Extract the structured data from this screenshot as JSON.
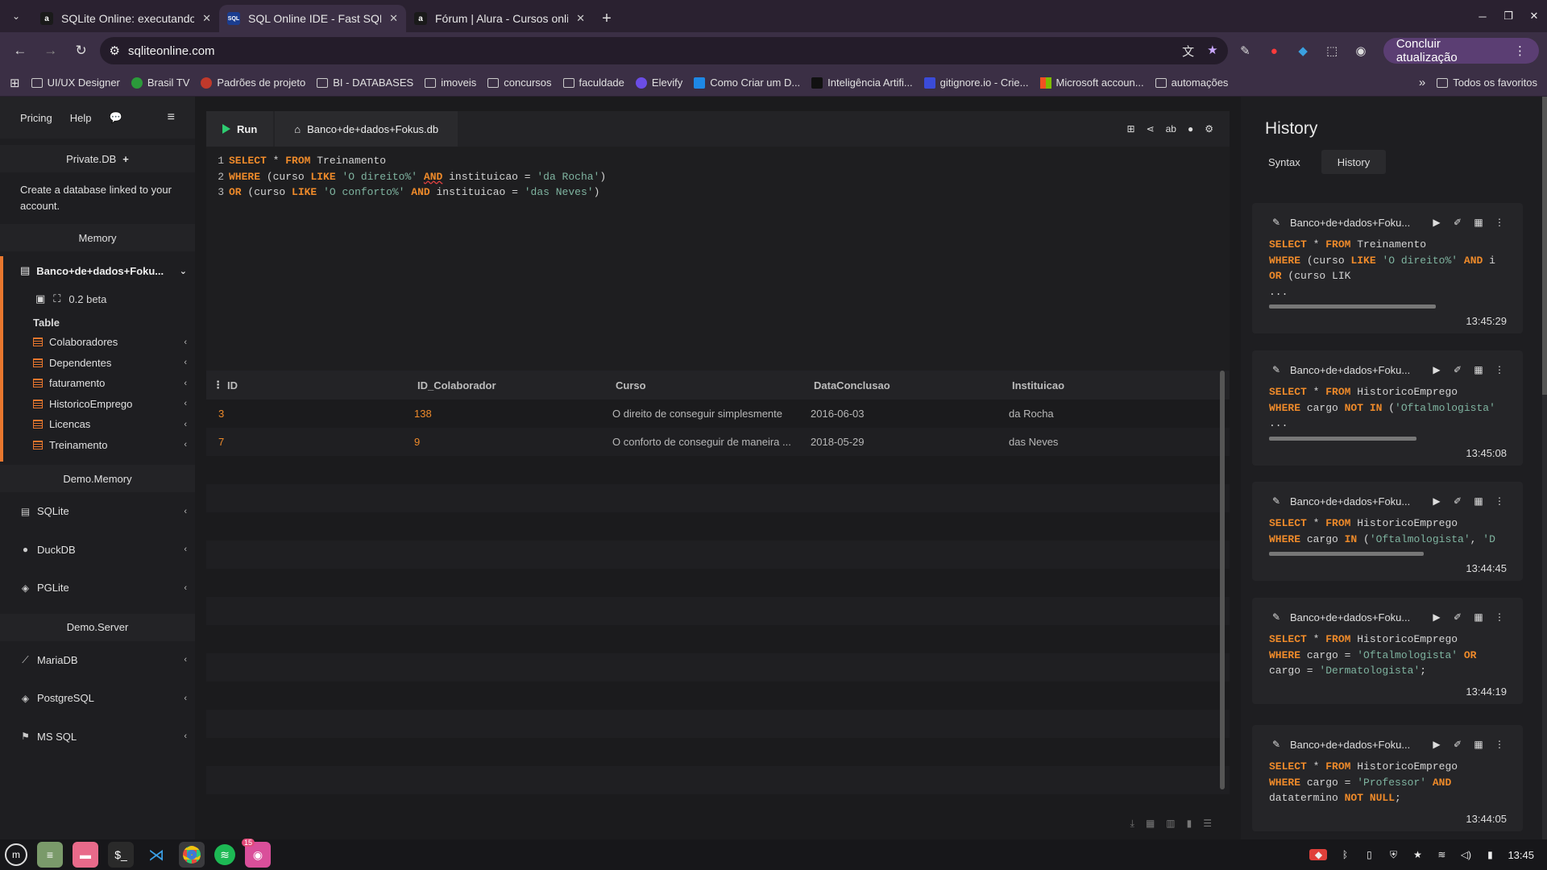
{
  "browser": {
    "tabs": [
      {
        "title": "SQLite Online: executando c",
        "favicon": "a",
        "active": false
      },
      {
        "title": "SQL Online IDE - Fast SQL Ed",
        "favicon": "SQL",
        "active": true
      },
      {
        "title": "Fórum | Alura - Cursos online",
        "favicon": "a",
        "active": false
      }
    ],
    "url": "sqliteonline.com",
    "update_label": "Concluir atualização",
    "bookmarks": [
      {
        "label": "UI/UX Designer",
        "icon": "folder-icon"
      },
      {
        "label": "Brasil TV",
        "icon": "brasiltv-icon"
      },
      {
        "label": "Padrões de projeto",
        "icon": "pattern-icon"
      },
      {
        "label": "BI - DATABASES",
        "icon": "folder-icon"
      },
      {
        "label": "imoveis",
        "icon": "folder-icon"
      },
      {
        "label": "concursos",
        "icon": "folder-icon"
      },
      {
        "label": "faculdade",
        "icon": "folder-icon"
      },
      {
        "label": "Elevify",
        "icon": "elevify-icon"
      },
      {
        "label": "Como Criar um D...",
        "icon": "video-icon"
      },
      {
        "label": "Inteligência Artifi...",
        "icon": "alura-icon"
      },
      {
        "label": "gitignore.io - Crie...",
        "icon": "git-icon"
      },
      {
        "label": "Microsoft accoun...",
        "icon": "microsoft-icon"
      },
      {
        "label": "automações",
        "icon": "folder-icon"
      }
    ],
    "bookmarks_all": "Todos os favoritos"
  },
  "sidebar": {
    "nav": {
      "pricing": "Pricing",
      "help": "Help"
    },
    "private_db": "Private.DB",
    "private_note": "Create a database linked to your account.",
    "memory": "Memory",
    "db_name": "Banco+de+dados+Foku...",
    "db_version": "0.2 beta",
    "table_header": "Table",
    "tables": [
      "Colaboradores",
      "Dependentes",
      "faturamento",
      "HistoricoEmprego",
      "Licencas",
      "Treinamento"
    ],
    "demo_memory": "Demo.Memory",
    "memory_engines": [
      "SQLite",
      "DuckDB",
      "PGLite"
    ],
    "demo_server": "Demo.Server",
    "server_engines": [
      "MariaDB",
      "PostgreSQL",
      "MS SQL"
    ]
  },
  "editor": {
    "run_label": "Run",
    "db_tab": "Banco+de+dados+Fokus.db",
    "lines": [
      {
        "n": "1"
      },
      {
        "n": "2"
      },
      {
        "n": "3"
      }
    ]
  },
  "results": {
    "columns": [
      "ID",
      "ID_Colaborador",
      "Curso",
      "DataConclusao",
      "Instituicao"
    ],
    "rows": [
      [
        "3",
        "138",
        "O direito de conseguir simplesmente",
        "2016-06-03",
        "da Rocha"
      ],
      [
        "7",
        "9",
        "O conforto de conseguir de maneira ...",
        "2018-05-29",
        "das Neves"
      ]
    ]
  },
  "history": {
    "title": "History",
    "tabs": [
      "Syntax",
      "History"
    ],
    "entries": [
      {
        "name": "Banco+de+dados+Foku...",
        "time": "13:45:29",
        "progress": 0.7
      },
      {
        "name": "Banco+de+dados+Foku...",
        "time": "13:45:08",
        "progress": 0.62
      },
      {
        "name": "Banco+de+dados+Foku...",
        "time": "13:44:45",
        "progress": 0.65
      },
      {
        "name": "Banco+de+dados+Foku...",
        "time": "13:44:19"
      },
      {
        "name": "Banco+de+dados+Foku...",
        "time": "13:44:05"
      }
    ]
  },
  "taskbar": {
    "badge": "15",
    "clock": "13:45"
  },
  "colors": {
    "accent": "#e8772e",
    "run_green": "#2ecc71",
    "string": "#7fb4a0"
  }
}
